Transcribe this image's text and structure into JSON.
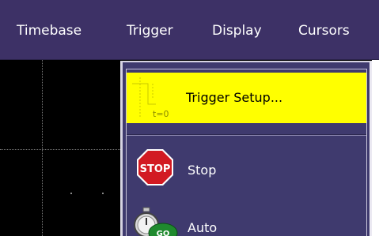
{
  "menubar": {
    "items": [
      {
        "label": "Timebase"
      },
      {
        "label": "Trigger"
      },
      {
        "label": "Display"
      },
      {
        "label": "Cursors"
      }
    ]
  },
  "trigger_menu": {
    "items": [
      {
        "label": "Trigger Setup...",
        "icon": "trigger-setup-icon",
        "icon_text": "t=0",
        "highlighted": true
      },
      {
        "label": "Stop",
        "icon": "stop-sign-icon",
        "icon_text": "STOP"
      },
      {
        "label": "Auto",
        "icon": "auto-stopwatch-icon",
        "icon_text": "GO"
      }
    ]
  },
  "colors": {
    "menubar_bg": "#3d3166",
    "menu_bg": "#3f3a6e",
    "highlight": "#ffff00",
    "scope_bg": "#000000",
    "stop_red": "#d21a22",
    "go_green": "#1f8a2e"
  }
}
